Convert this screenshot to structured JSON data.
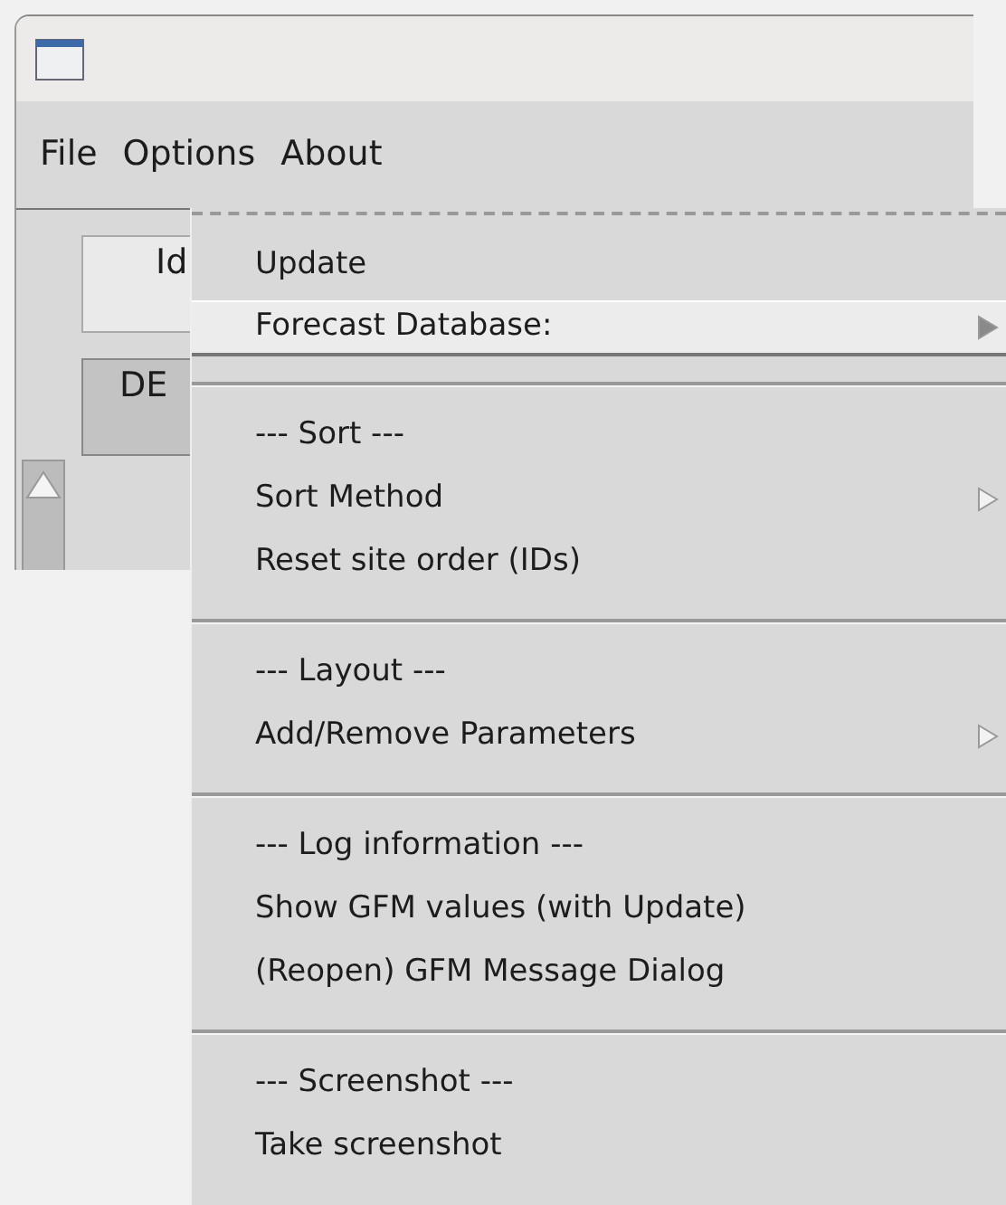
{
  "window": {
    "menubar": [
      {
        "label": "File"
      },
      {
        "label": "Options"
      },
      {
        "label": "About"
      }
    ]
  },
  "background_buttons": [
    {
      "label": "Id",
      "pressed": false
    },
    {
      "label": "DE",
      "pressed": true
    }
  ],
  "options_menu": [
    {
      "kind": "tearoff"
    },
    {
      "kind": "command",
      "label": "Update",
      "selected": false
    },
    {
      "kind": "cascade",
      "label": "Forecast Database:",
      "selected": true
    },
    {
      "kind": "separator"
    },
    {
      "kind": "command",
      "label": "--- Sort ---",
      "selected": false
    },
    {
      "kind": "cascade",
      "label": "Sort Method",
      "selected": false
    },
    {
      "kind": "command",
      "label": "Reset site order (IDs)",
      "selected": false
    },
    {
      "kind": "separator"
    },
    {
      "kind": "command",
      "label": "--- Layout ---",
      "selected": false
    },
    {
      "kind": "cascade",
      "label": "Add/Remove Parameters",
      "selected": false
    },
    {
      "kind": "separator"
    },
    {
      "kind": "command",
      "label": "--- Log information ---",
      "selected": false
    },
    {
      "kind": "command",
      "label": "Show GFM values (with Update)",
      "selected": false
    },
    {
      "kind": "command",
      "label": "(Reopen) GFM Message Dialog",
      "selected": false
    },
    {
      "kind": "separator"
    },
    {
      "kind": "command",
      "label": "--- Screenshot ---",
      "selected": false
    },
    {
      "kind": "command",
      "label": "Take screenshot",
      "selected": false
    }
  ]
}
